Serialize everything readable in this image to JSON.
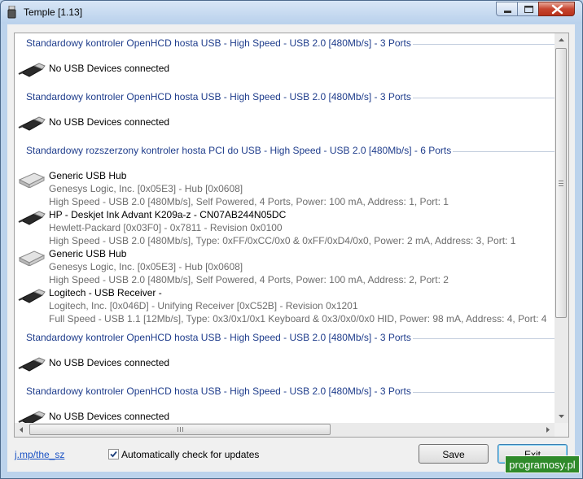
{
  "window": {
    "title": "Temple [1.13]"
  },
  "usb_list": [
    {
      "header": "Standardowy kontroler OpenHCD hosta USB - High Speed - USB 2.0 [480Mb/s] - 3 Ports",
      "devices": [
        {
          "icon": "usb-plug-icon",
          "name": "No USB Devices connected",
          "lines": []
        }
      ]
    },
    {
      "header": "Standardowy kontroler OpenHCD hosta USB - High Speed - USB 2.0 [480Mb/s] - 3 Ports",
      "devices": [
        {
          "icon": "usb-plug-icon",
          "name": "No USB Devices connected",
          "lines": []
        }
      ]
    },
    {
      "header": "Standardowy rozszerzony kontroler hosta PCI do USB - High Speed - USB 2.0 [480Mb/s] - 6 Ports",
      "devices": [
        {
          "icon": "usb-hub-icon",
          "name": "Generic USB Hub",
          "lines": [
            "Genesys Logic, Inc. [0x05E3] - Hub [0x0608]",
            "High Speed - USB 2.0 [480Mb/s], Self Powered, 4 Ports, Power: 100 mA, Address: 1, Port: 1"
          ]
        },
        {
          "icon": "usb-plug-icon",
          "name": "HP - Deskjet Ink Advant K209a-z - CN07AB244N05DC",
          "lines": [
            "Hewlett-Packard [0x03F0] - 0x7811 - Revision 0x0100",
            "High Speed - USB 2.0 [480Mb/s], Type: 0xFF/0xCC/0x0 & 0xFF/0xD4/0x0, Power: 2 mA, Address: 3, Port: 1"
          ]
        },
        {
          "icon": "usb-hub-icon",
          "name": "Generic USB Hub",
          "lines": [
            "Genesys Logic, Inc. [0x05E3] - Hub [0x0608]",
            "High Speed - USB 2.0 [480Mb/s], Self Powered, 4 Ports, Power: 100 mA, Address: 2, Port: 2"
          ]
        },
        {
          "icon": "usb-plug-icon",
          "name": "Logitech - USB Receiver -",
          "lines": [
            "Logitech, Inc. [0x046D] - Unifying Receiver [0xC52B] - Revision 0x1201",
            "Full Speed - USB 1.1 [12Mb/s], Type: 0x3/0x1/0x1 Keyboard & 0x3/0x0/0x0 HID, Power: 98 mA, Address: 4, Port: 4"
          ]
        }
      ]
    },
    {
      "header": "Standardowy kontroler OpenHCD hosta USB - High Speed - USB 2.0 [480Mb/s] - 3 Ports",
      "devices": [
        {
          "icon": "usb-plug-icon",
          "name": "No USB Devices connected",
          "lines": []
        }
      ]
    },
    {
      "header": "Standardowy kontroler OpenHCD hosta USB - High Speed - USB 2.0 [480Mb/s] - 3 Ports",
      "devices": [
        {
          "icon": "usb-plug-icon",
          "name": "No USB Devices connected",
          "lines": []
        }
      ]
    }
  ],
  "footer": {
    "link": "j.mp/the_sz",
    "auto_check_label": "Automatically check for updates",
    "auto_check_checked": true,
    "save_label": "Save",
    "exit_label": "Exit"
  },
  "watermark": "programosy.pl",
  "colors": {
    "header_text": "#1f3d8c",
    "sub_text": "#6d6d6d",
    "link": "#1a52c4",
    "watermark_bg": "#2f8a2a"
  }
}
